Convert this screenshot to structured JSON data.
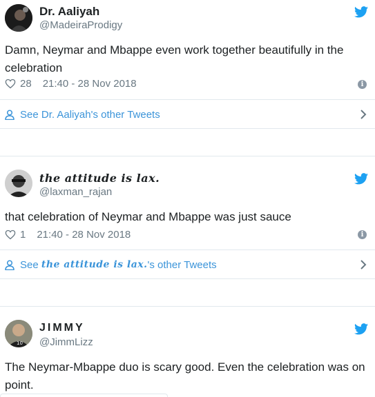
{
  "tweets": [
    {
      "name": "Dr. Aaliyah",
      "handle": "@MadeiraProdigy",
      "text": "Damn, Neymar and Mbappe even work together beautifully in the celebration",
      "likes": "28",
      "timestamp": "21:40 - 28 Nov 2018",
      "other_prefix": "See ",
      "other_name": "Dr. Aaliyah",
      "other_suffix": "'s other Tweets"
    },
    {
      "name": "the attitude is lax.",
      "handle": "@laxman_rajan",
      "text": "that celebration of Neymar and Mbappe was just sauce",
      "likes": "1",
      "timestamp": "21:40 - 28 Nov 2018",
      "other_prefix": "See ",
      "other_name": "the attitude is lax.",
      "other_suffix": "'s other Tweets"
    },
    {
      "name": "JIMMY",
      "handle": "@JimmLizz",
      "text": "The Neymar-Mbappe duo is scary good. Even the celebration was on point."
    }
  ],
  "colors": {
    "twitter_blue": "#1da1f2",
    "link_blue": "#3b94d9",
    "meta_gray": "#697882",
    "divider": "#e1e8ed"
  },
  "icons": {
    "brand": "twitter-bird-icon",
    "like": "heart-icon",
    "info": "info-icon",
    "profile": "user-icon",
    "chevron": "chevron-right-icon"
  }
}
